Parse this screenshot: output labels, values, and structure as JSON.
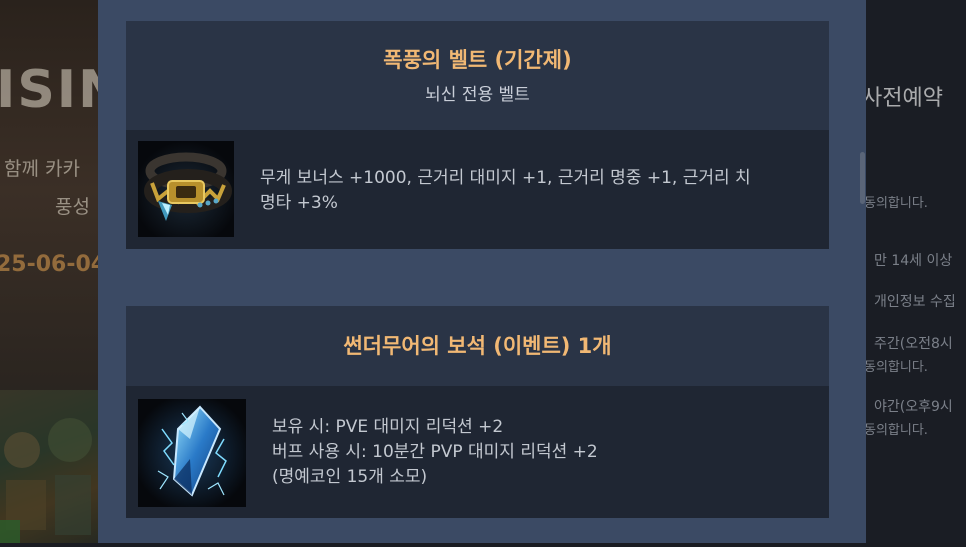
{
  "background": {
    "left_title": "ISIN",
    "left_line1": "함께 카카",
    "left_line2": "풍성",
    "left_date": "25-06-04",
    "right_title": "사전예약",
    "right_lines": [
      "동의합니다.",
      "만 14세 이상",
      "개인정보 수집",
      "주간(오전8시",
      "동의합니다.",
      "야간(오후9시",
      "동의합니다."
    ]
  },
  "items": [
    {
      "title": "폭풍의 벨트 (기간제)",
      "subtitle": "뇌신 전용 벨트",
      "icon": "storm-belt-icon",
      "description": [
        "무게 보너스 +1000, 근거리 대미지 +1, 근거리 명중 +1, 근거리 치",
        "명타 +3%"
      ]
    },
    {
      "title": "썬더무어의 보석 (이벤트) 1개",
      "icon": "thundermoor-gem-icon",
      "description": [
        "보유 시: PVE 대미지 리덕션 +2",
        "버프 사용 시: 10분간 PVP 대미지 리덕션 +2",
        "(명예코인 15개 소모)"
      ]
    }
  ],
  "colors": {
    "modal_bg": "#3b4a64",
    "card_header_bg": "#2a3446",
    "card_body_bg": "#1f2633",
    "title_accent": "#f1b874"
  }
}
